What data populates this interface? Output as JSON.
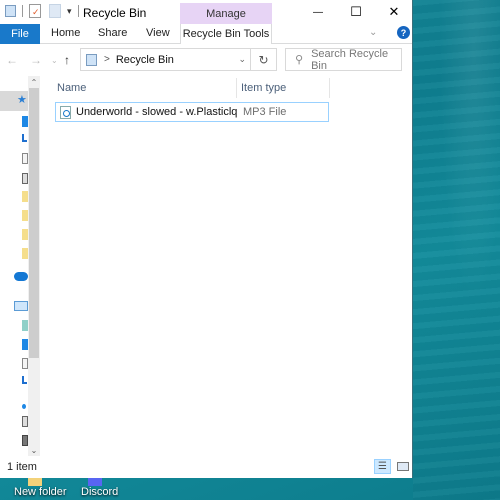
{
  "window": {
    "title": "Recycle Bin",
    "contextual_group": "Manage",
    "controls": {
      "minimize": "—",
      "maximize": "☐",
      "close": "✕"
    }
  },
  "ribbon": {
    "tabs": [
      {
        "label": "File"
      },
      {
        "label": "Home"
      },
      {
        "label": "Share"
      },
      {
        "label": "View"
      },
      {
        "label": "Recycle Bin Tools"
      }
    ],
    "expand_icon": "⌄",
    "help_icon": "?"
  },
  "navigation": {
    "back_icon": "←",
    "forward_icon": "→",
    "recent_icon": "⌄",
    "up_icon": "↑",
    "breadcrumb_sep": ">",
    "address": "Recycle Bin",
    "dropdown_icon": "⌄",
    "refresh_icon": "↻",
    "search_placeholder": "Search Recycle Bin",
    "search_icon": "⚲"
  },
  "file_list": {
    "columns": [
      "Name",
      "Item type"
    ],
    "items": [
      {
        "name": "Underworld - slowed - w.Plasticlq",
        "type": "MP3 File",
        "selected": true
      }
    ]
  },
  "scrollbar": {
    "up": "⌃",
    "down": "⌄"
  },
  "status_bar": {
    "item_count": "1 item",
    "views": [
      "Details",
      "Large icons"
    ],
    "active_view": "Details"
  },
  "desktop": {
    "icons": [
      {
        "label": "New folder"
      },
      {
        "label": "Discord"
      }
    ]
  },
  "colors": {
    "file_tab": "#1979ca",
    "manage_tab": "#e7d4f5",
    "selection_border": "#99d1ff",
    "desktop": "#0e7f91"
  }
}
